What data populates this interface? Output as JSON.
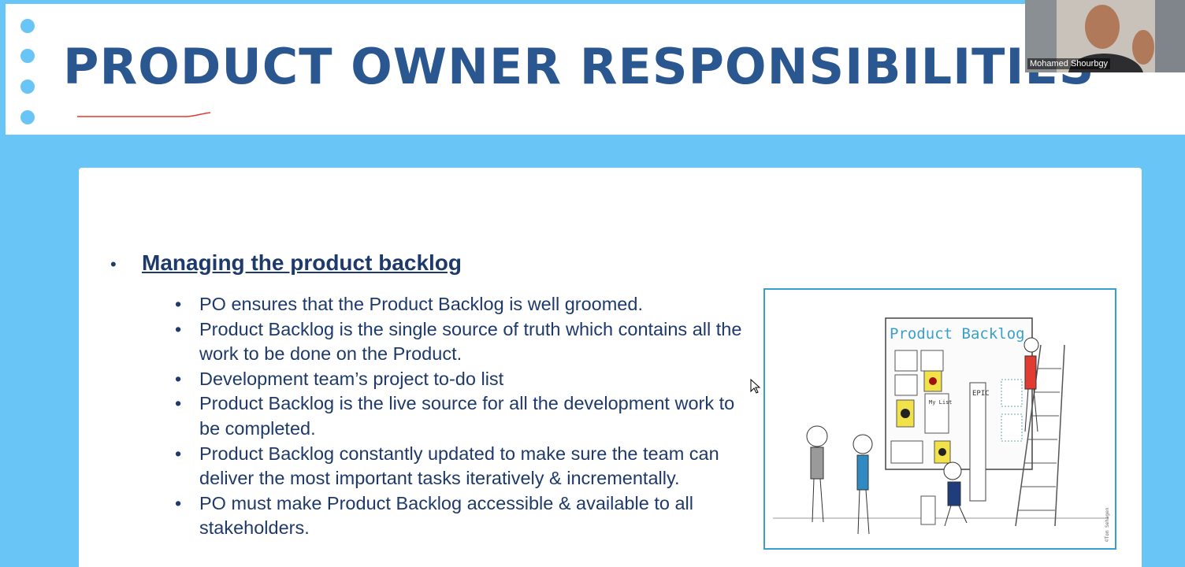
{
  "slide": {
    "title": "PRODUCT OWNER RESPONSIBILITIES",
    "heading": "Managing the product backlog",
    "bullet_symbol": "•",
    "points": [
      "PO ensures that the Product Backlog is well groomed.",
      "Product Backlog is the single source of truth which contains all the work to be done on the Product.",
      "Development team’s project to-do list",
      "Product Backlog is the live source for all the development work to be completed.",
      "Product Backlog constantly updated to make sure the team can deliver the most important tasks iteratively & incrementally.",
      "PO must make Product Backlog accessible & available to all stakeholders."
    ],
    "illustration": {
      "board_title": "Product Backlog",
      "epic_label": "EPIC",
      "list_label": "My List",
      "credit": "©Tom Sehagen"
    }
  },
  "webcam": {
    "participant_name": "Mohamed Shourbgy"
  },
  "colors": {
    "background": "#6ac5f7",
    "title": "#2b5791",
    "text": "#1e3a6a",
    "frame": "#3a9fcf"
  }
}
